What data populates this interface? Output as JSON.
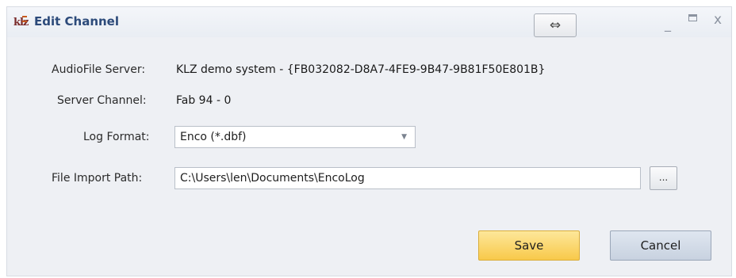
{
  "window": {
    "logo_text": "klz",
    "title": "Edit Channel",
    "resize_glyph": "⇔",
    "min_glyph": "_",
    "close_glyph": "x"
  },
  "fields": {
    "audiofile_server": {
      "label": "AudioFile Server:",
      "value": "KLZ demo system - {FB032082-D8A7-4FE9-9B47-9B81F50E801B}"
    },
    "server_channel": {
      "label": "Server Channel:",
      "value": "Fab 94 - 0"
    },
    "log_format": {
      "label": "Log Format:",
      "value": "Enco (*.dbf)"
    },
    "file_import_path": {
      "label": "File Import Path:",
      "value": "C:\\Users\\len\\Documents\\EncoLog",
      "browse_label": "..."
    }
  },
  "buttons": {
    "save": "Save",
    "cancel": "Cancel"
  },
  "colors": {
    "title": "#2c4a7a",
    "save_bg": "#f8c94a",
    "cancel_bg": "#c8d2e0",
    "window_bg": "#eef0f4"
  }
}
